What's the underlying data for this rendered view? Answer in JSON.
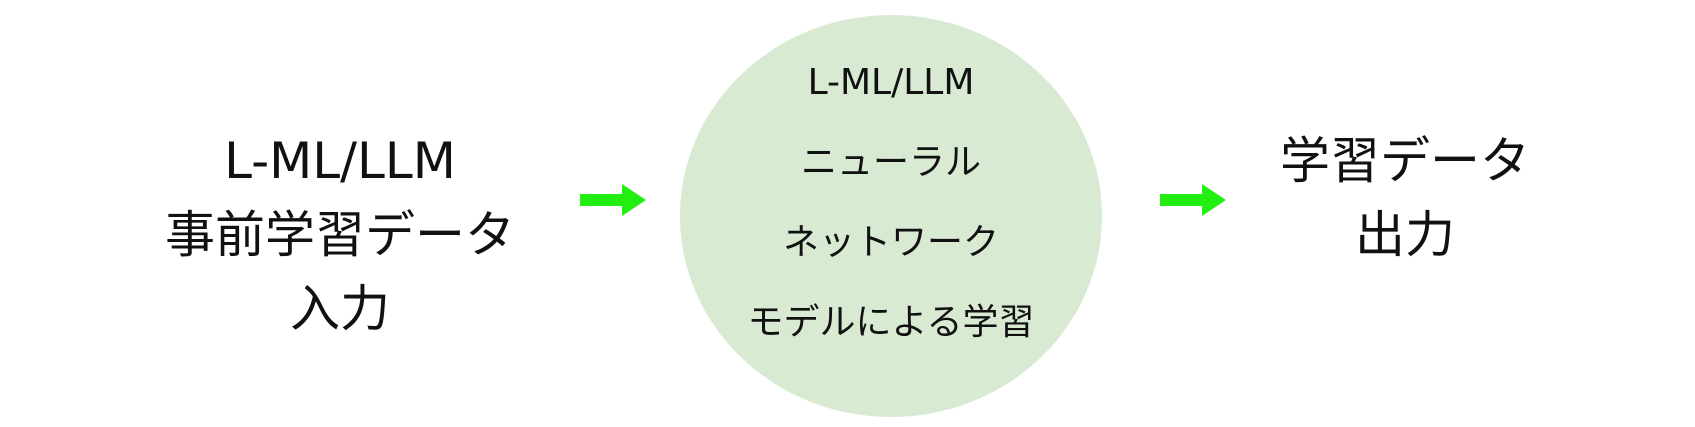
{
  "input": {
    "lines": [
      "L-ML/LLM",
      "事前学習データ",
      "入力"
    ]
  },
  "process": {
    "lines": [
      "L-ML/LLM",
      "ニューラル",
      "ネットワーク",
      "モデルによる学習"
    ]
  },
  "output": {
    "lines": [
      "学習データ",
      "出力"
    ]
  },
  "colors": {
    "arrow": "#22ee11",
    "circle_fill": "#d9ead3",
    "text": "#111111"
  }
}
